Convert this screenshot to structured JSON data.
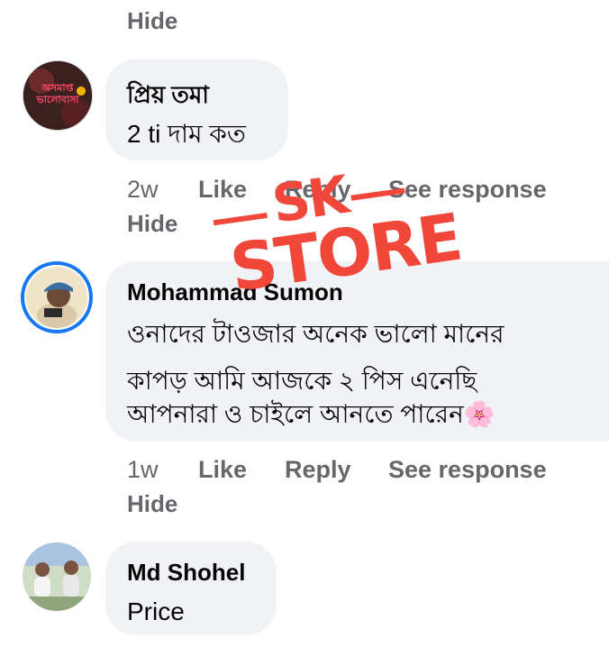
{
  "top": {
    "hide_label": "Hide"
  },
  "comments": [
    {
      "author": "প্রিয় তমা",
      "text_lines": [
        "2 ti দাম কত"
      ],
      "time": "2w",
      "like": "Like",
      "reply": "Reply",
      "see_response": "See response",
      "hide": "Hide",
      "avatar_text": [
        "অসমাপ্ত",
        "ভালোবাসা"
      ]
    },
    {
      "author": "Mohammad Sumon",
      "text_lines": [
        "ওনাদের টাওজার অনেক ভালো মানের",
        "কাপড় আমি আজকে ২ পিস এনেছি",
        "আপনারা ও চাইলে আনতে পারেন"
      ],
      "emoji": "🌸",
      "time": "1w",
      "like": "Like",
      "reply": "Reply",
      "see_response": "See response",
      "hide": "Hide"
    },
    {
      "author": "Md Shohel",
      "text_lines": [
        "Price"
      ]
    }
  ],
  "watermark": {
    "line1": "SK",
    "line2": "STORE",
    "color": "#f0473a"
  }
}
